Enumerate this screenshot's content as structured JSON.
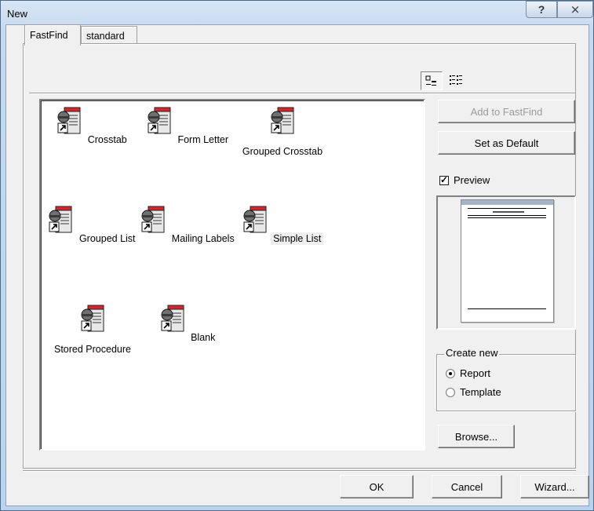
{
  "window": {
    "title": "New"
  },
  "titlebar_buttons": {
    "help": "?",
    "close": "⨯"
  },
  "tabs": [
    {
      "label": "FastFind",
      "active": true
    },
    {
      "label": "standard",
      "active": false
    }
  ],
  "templates": [
    {
      "label": "Crosstab",
      "icon": "report-template-icon"
    },
    {
      "label": "Form Letter",
      "icon": "report-template-icon"
    },
    {
      "label": "Grouped Crosstab",
      "icon": "report-template-icon"
    },
    {
      "label": "Grouped List",
      "icon": "report-template-icon"
    },
    {
      "label": "Mailing Labels",
      "icon": "report-template-icon"
    },
    {
      "label": "Simple List",
      "icon": "report-template-icon",
      "selected": true
    },
    {
      "label": "Stored Procedure",
      "icon": "report-template-icon"
    },
    {
      "label": "Blank",
      "icon": "report-template-icon"
    }
  ],
  "actions": {
    "add_to_fastfind": "Add to FastFind",
    "set_as_default": "Set as Default",
    "browse": "Browse..."
  },
  "preview": {
    "label": "Preview",
    "checked": true
  },
  "create_new": {
    "legend": "Create new",
    "options": [
      {
        "label": "Report",
        "selected": true
      },
      {
        "label": "Template",
        "selected": false
      }
    ]
  },
  "footer": {
    "ok": "OK",
    "cancel": "Cancel",
    "wizard": "Wizard..."
  },
  "colors": {
    "titlebar": "#c6d9ef",
    "dialog_bg": "#f0f0f0",
    "list_bg": "#ffffff"
  }
}
